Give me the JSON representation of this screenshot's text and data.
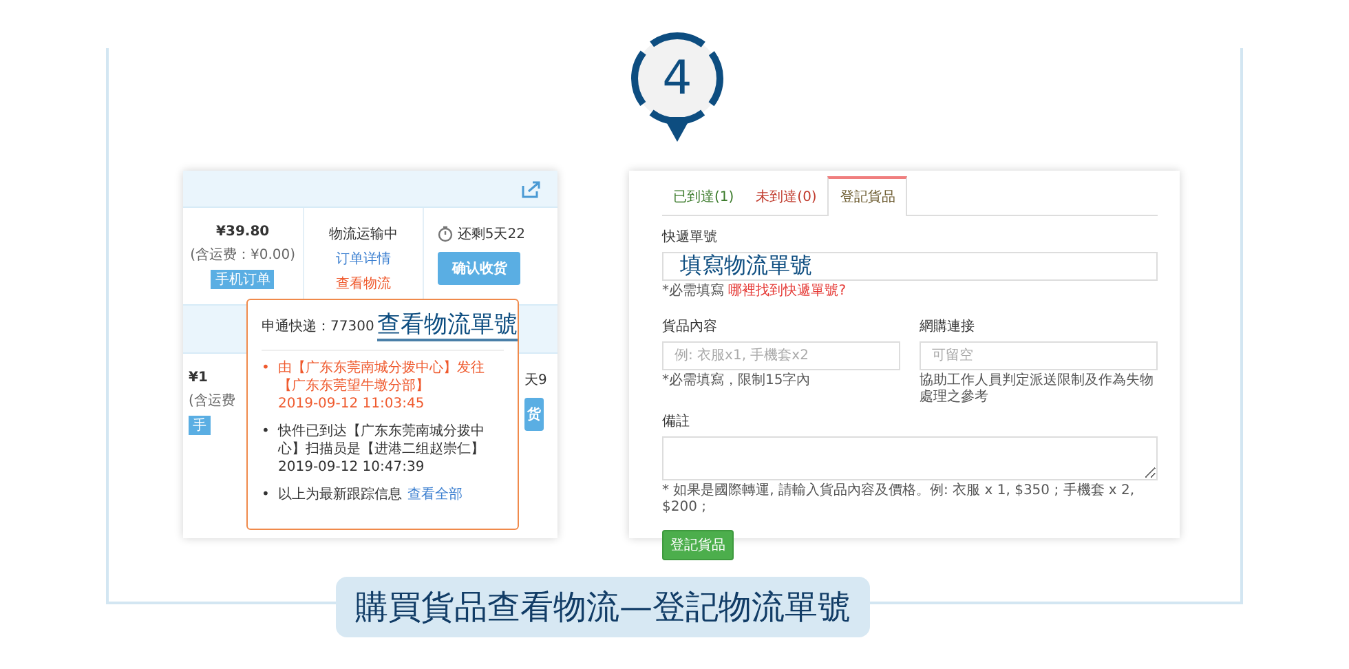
{
  "step": {
    "number": "4"
  },
  "left_screenshot": {
    "order_row": {
      "price": "¥39.80",
      "shipping": "(含运费：¥0.00)",
      "badge": "手机订单",
      "status": "物流运输中",
      "detail_link": "订单详情",
      "logistics_link": "查看物流",
      "countdown": "还剩5天22",
      "confirm_button": "确认收货"
    },
    "second_row": {
      "price": "¥1",
      "shipping": "(含运费",
      "badge": "手",
      "countdown": "天9",
      "confirm_button": "货"
    },
    "popup": {
      "carrier": "申通快递：77300",
      "annotation": "查看物流單號",
      "events": [
        {
          "marker": "•",
          "text": "由【广东东莞南城分拨中心】发往【广东东莞望牛墩分部】",
          "time": "2019-09-12 11:03:45",
          "latest": true
        },
        {
          "marker": "•",
          "text": "快件已到达【广东东莞南城分拨中心】扫描员是【进港二组赵崇仁】",
          "time": "2019-09-12 10:47:39",
          "latest": false
        }
      ],
      "footer_marker": "•",
      "footer": "以上为最新跟踪信息",
      "footer_link": "查看全部"
    }
  },
  "right_screenshot": {
    "tabs": [
      {
        "label": "已到達(1)",
        "color": "#3a7a2a",
        "selected": false
      },
      {
        "label": "未到達(0)",
        "color": "#c0392b",
        "selected": false
      },
      {
        "label": "登記貨品",
        "color": "#6b5a2e",
        "selected": true
      }
    ],
    "tracking": {
      "label": "快遞單號",
      "annotation": "填寫物流單號",
      "help": "*必需填寫",
      "help_link": "哪裡找到快遞單號?"
    },
    "contents": {
      "label": "貨品內容",
      "placeholder": "例: 衣服x1, 手機套x2",
      "help": "*必需填寫，限制15字內"
    },
    "link": {
      "label": "網購連接",
      "placeholder": "可留空",
      "help": "協助工作人員判定派送限制及作為失物處理之參考"
    },
    "remarks": {
      "label": "備註",
      "help": "* 如果是國際轉運, 請輸入貨品內容及價格。例: 衣服 x 1, $350 ; 手機套 x 2, $200 ;"
    },
    "submit_button": "登記貨品"
  },
  "caption": "購買貨品查看物流—登記物流單號"
}
